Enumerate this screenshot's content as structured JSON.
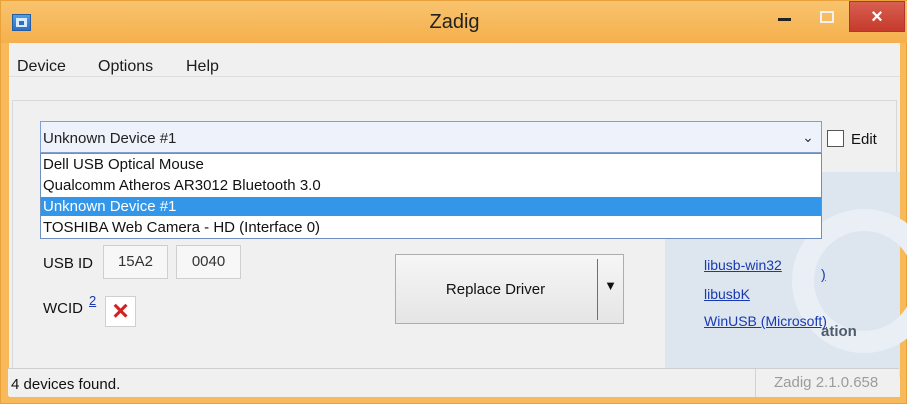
{
  "window": {
    "title": "Zadig",
    "close_glyph": "×"
  },
  "menu": {
    "items": [
      "Device",
      "Options",
      "Help"
    ]
  },
  "device_select": {
    "value": "Unknown Device #1",
    "edit_label": "Edit",
    "options": [
      "Dell USB Optical Mouse",
      "Qualcomm Atheros AR3012 Bluetooth 3.0",
      "Unknown Device #1",
      "TOSHIBA Web Camera - HD (Interface 0)"
    ],
    "selected_index": 2
  },
  "usb": {
    "label": "USB ID",
    "vendor": "15A2",
    "product": "0040",
    "wcid_label": "WCID",
    "wcid_link": "2",
    "wcid_status_icon": "close-icon"
  },
  "action": {
    "replace_label": "Replace Driver"
  },
  "info_panel": {
    "heading_fragment": "ation",
    "links": [
      "libusb-win32",
      "libusbK",
      "WinUSB (Microsoft)"
    ],
    "partial_link_fragment": ")"
  },
  "status": {
    "message": "4 devices found.",
    "version": "Zadig 2.1.0.658"
  },
  "colors": {
    "titlebar": "#f6ba5a",
    "selection": "#3396e8",
    "link": "#1839b1",
    "status_error": "#d42020"
  }
}
